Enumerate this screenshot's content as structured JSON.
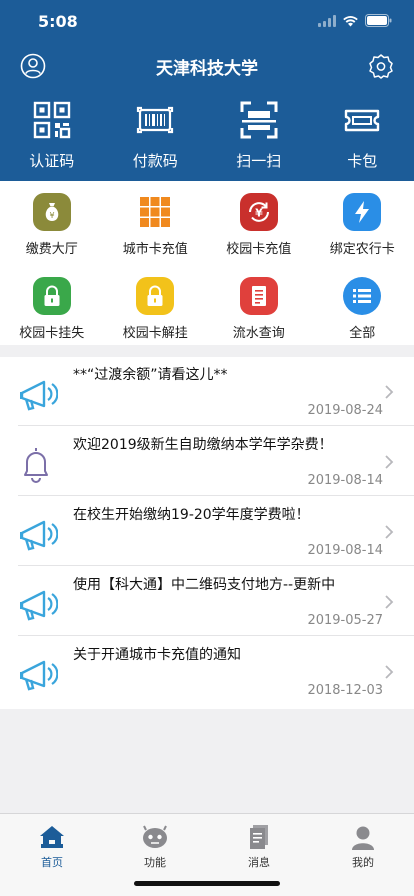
{
  "status_bar": {
    "time": "5:08"
  },
  "header": {
    "title": "天津科技大学",
    "quick_actions": [
      {
        "label": "认证码",
        "icon": "qr-code-icon"
      },
      {
        "label": "付款码",
        "icon": "barcode-icon"
      },
      {
        "label": "扫一扫",
        "icon": "scan-icon"
      },
      {
        "label": "卡包",
        "icon": "card-wallet-icon"
      }
    ]
  },
  "functions": [
    {
      "label": "缴费大厅",
      "icon": "money-bag-icon",
      "color": "#8b8a3a"
    },
    {
      "label": "城市卡充值",
      "icon": "grid-icon",
      "color": "#f0891e"
    },
    {
      "label": "校园卡充值",
      "icon": "yuan-refresh-icon",
      "color": "#c9302c"
    },
    {
      "label": "绑定农行卡",
      "icon": "lightning-icon",
      "color": "#2a8ee6"
    },
    {
      "label": "校园卡挂失",
      "icon": "lock-icon",
      "color": "#3aa84a"
    },
    {
      "label": "校园卡解挂",
      "icon": "unlock-icon",
      "color": "#f2c21a"
    },
    {
      "label": "流水查询",
      "icon": "document-icon",
      "color": "#e0403c"
    },
    {
      "label": "全部",
      "icon": "list-icon",
      "color": "#2a8ee6"
    }
  ],
  "news": [
    {
      "title": "**“过渡余额”请看这儿**",
      "date": "2019-08-24",
      "icon": "megaphone-icon"
    },
    {
      "title": "欢迎2019级新生自助缴纳本学年学杂费！",
      "date": "2019-08-14",
      "icon": "bell-icon"
    },
    {
      "title": "在校生开始缴纳19-20学年度学费啦！",
      "date": "2019-08-14",
      "icon": "megaphone-icon"
    },
    {
      "title": "使用【科大通】中二维码支付地方--更新中",
      "date": "2019-05-27",
      "icon": "megaphone-icon"
    },
    {
      "title": "关于开通城市卡充值的通知",
      "date": "2018-12-03",
      "icon": "megaphone-icon"
    }
  ],
  "tabbar": [
    {
      "label": "首页",
      "icon": "home-icon",
      "active": true
    },
    {
      "label": "功能",
      "icon": "robot-icon",
      "active": false
    },
    {
      "label": "消息",
      "icon": "message-doc-icon",
      "active": false
    },
    {
      "label": "我的",
      "icon": "person-icon",
      "active": false
    }
  ],
  "colors": {
    "header_bg": "#1c5c98",
    "accent": "#1c5c98",
    "megaphone": "#3aa5dc"
  }
}
